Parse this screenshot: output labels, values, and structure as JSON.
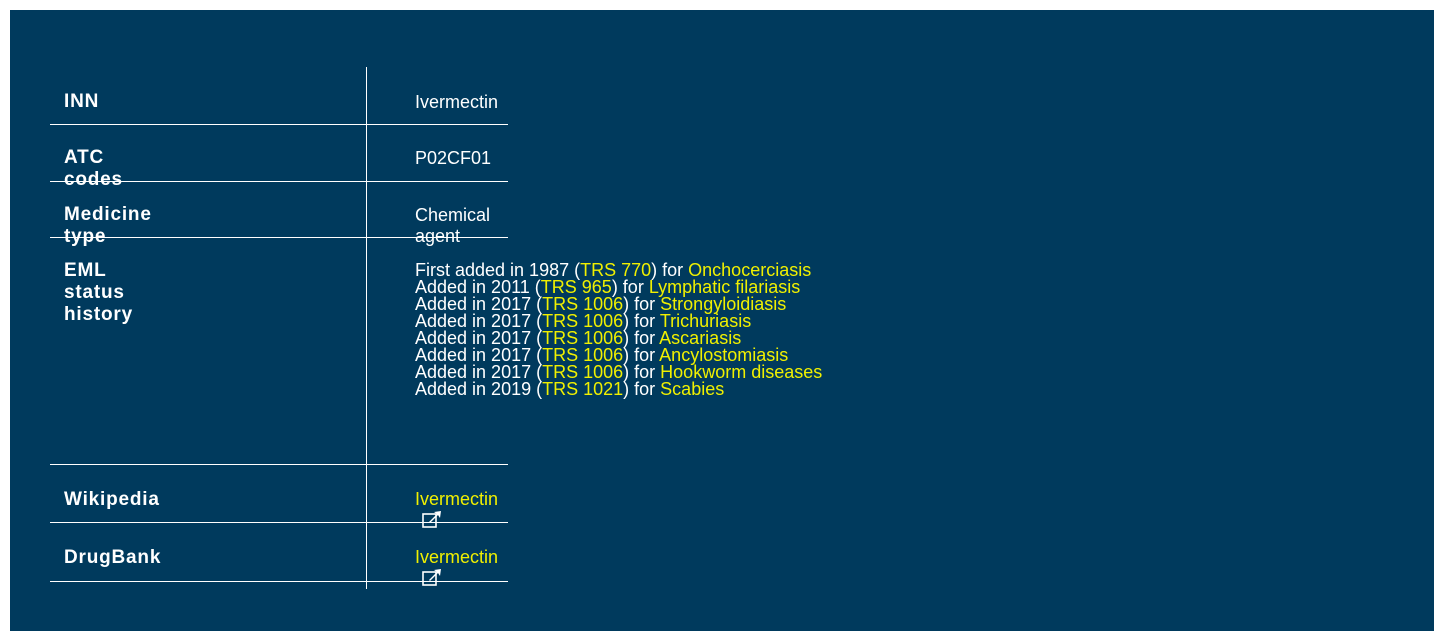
{
  "rows": {
    "inn": {
      "label": "INN",
      "value": "Ivermectin"
    },
    "atc": {
      "label": "ATC codes",
      "value": "P02CF01"
    },
    "type": {
      "label": "Medicine type",
      "value": "Chemical agent"
    },
    "eml": {
      "label": "EML status history",
      "entries": [
        {
          "prefix": "First added in 1987 (",
          "trs": "TRS 770",
          "mid": ") for ",
          "disease": "Onchocerciasis"
        },
        {
          "prefix": "Added in 2011 (",
          "trs": "TRS 965",
          "mid": ") for ",
          "disease": "Lymphatic filariasis"
        },
        {
          "prefix": "Added in 2017 (",
          "trs": "TRS 1006",
          "mid": ") for ",
          "disease": "Strongyloidiasis"
        },
        {
          "prefix": "Added in 2017 (",
          "trs": "TRS 1006",
          "mid": ") for ",
          "disease": "Trichuriasis"
        },
        {
          "prefix": "Added in 2017 (",
          "trs": "TRS 1006",
          "mid": ") for ",
          "disease": "Ascariasis"
        },
        {
          "prefix": "Added in 2017 (",
          "trs": "TRS 1006",
          "mid": ") for ",
          "disease": "Ancylostomiasis"
        },
        {
          "prefix": "Added in 2017 (",
          "trs": "TRS 1006",
          "mid": ") for ",
          "disease": "Hookworm diseases"
        },
        {
          "prefix": "Added in 2019 (",
          "trs": "TRS 1021",
          "mid": ") for ",
          "disease": "Scabies"
        }
      ]
    },
    "wikipedia": {
      "label": "Wikipedia",
      "link": "Ivermectin",
      "icon": "external-link-icon"
    },
    "drugbank": {
      "label": "DrugBank",
      "link": "Ivermectin",
      "icon": "external-link-icon"
    }
  },
  "colors": {
    "background": "#003a5d",
    "text": "#ffffff",
    "link": "#f0f000"
  }
}
